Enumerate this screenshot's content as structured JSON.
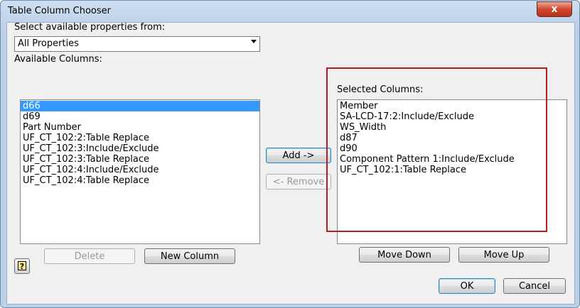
{
  "window": {
    "title": "Table Column Chooser",
    "close_glyph": "x"
  },
  "source": {
    "label": "Select available properties from:",
    "selected": "All Properties"
  },
  "available": {
    "label": "Available Columns:",
    "items": [
      "d66",
      "d69",
      "Part Number",
      "UF_CT_102:2:Table Replace",
      "UF_CT_102:3:Include/Exclude",
      "UF_CT_102:3:Table Replace",
      "UF_CT_102:4:Include/Exclude",
      "UF_CT_102:4:Table Replace"
    ],
    "selected_index": 0
  },
  "selected": {
    "label": "Selected Columns:",
    "items": [
      "Member",
      "SA-LCD-17:2:Include/Exclude",
      "WS_Width",
      "d87",
      "d90",
      "Component Pattern 1:Include/Exclude",
      "UF_CT_102:1:Table Replace"
    ]
  },
  "buttons": {
    "add": "Add ->",
    "remove": "<- Remove",
    "delete": "Delete",
    "new_column": "New Column",
    "move_down": "Move Down",
    "move_up": "Move Up",
    "ok": "OK",
    "cancel": "Cancel",
    "help_glyph": "?"
  },
  "annotation": {
    "color": "#b21e22"
  }
}
